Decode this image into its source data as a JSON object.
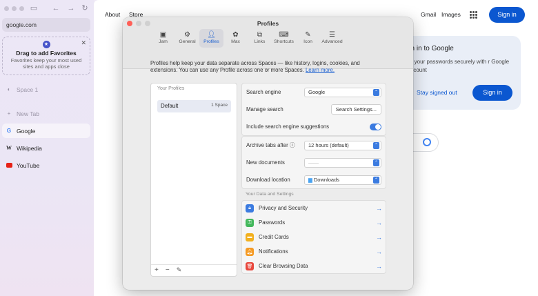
{
  "sidebar": {
    "url": "google.com",
    "favorites_title": "Drag to add Favorites",
    "favorites_sub": "Favorites keep your most used sites and apps close",
    "space": "Space 1",
    "new_tab": "New Tab",
    "tabs": [
      "Google",
      "Wikipedia",
      "YouTube"
    ]
  },
  "google": {
    "nav_left": [
      "About",
      "Store"
    ],
    "nav_right": [
      "Gmail",
      "Images"
    ],
    "signin": "Sign in",
    "card_title": "gn in to Google",
    "card_body": "ve your passwords securely with r Google Account",
    "card_stay": "Stay signed out",
    "card_signin": "Sign in"
  },
  "dialog": {
    "title": "Profiles",
    "tabs": [
      "Jam",
      "General",
      "Profiles",
      "Max",
      "Links",
      "Shortcuts",
      "Icon",
      "Advanced"
    ],
    "description": "Profiles help keep your data separate across Spaces — like history, logins, cookies, and extensions. You can use any Profile across one or more Spaces.",
    "learn_more": "Learn more.",
    "your_profiles": "Your Profiles",
    "profile_name": "Default",
    "profile_spaces": "1 Space",
    "search_engine_label": "Search engine",
    "search_engine_value": "Google",
    "manage_search_label": "Manage search",
    "manage_search_button": "Search Settings...",
    "suggestions_label": "Include search engine suggestions",
    "archive_label": "Archive tabs after",
    "archive_value": "12 hours (default)",
    "new_docs_label": "New documents",
    "new_docs_value": "——",
    "download_label": "Download location",
    "download_value": "Downloads",
    "data_settings_header": "Your Data and Settings",
    "links": [
      "Privacy and Security",
      "Passwords",
      "Credit Cards",
      "Notifications",
      "Clear Browsing Data"
    ]
  }
}
